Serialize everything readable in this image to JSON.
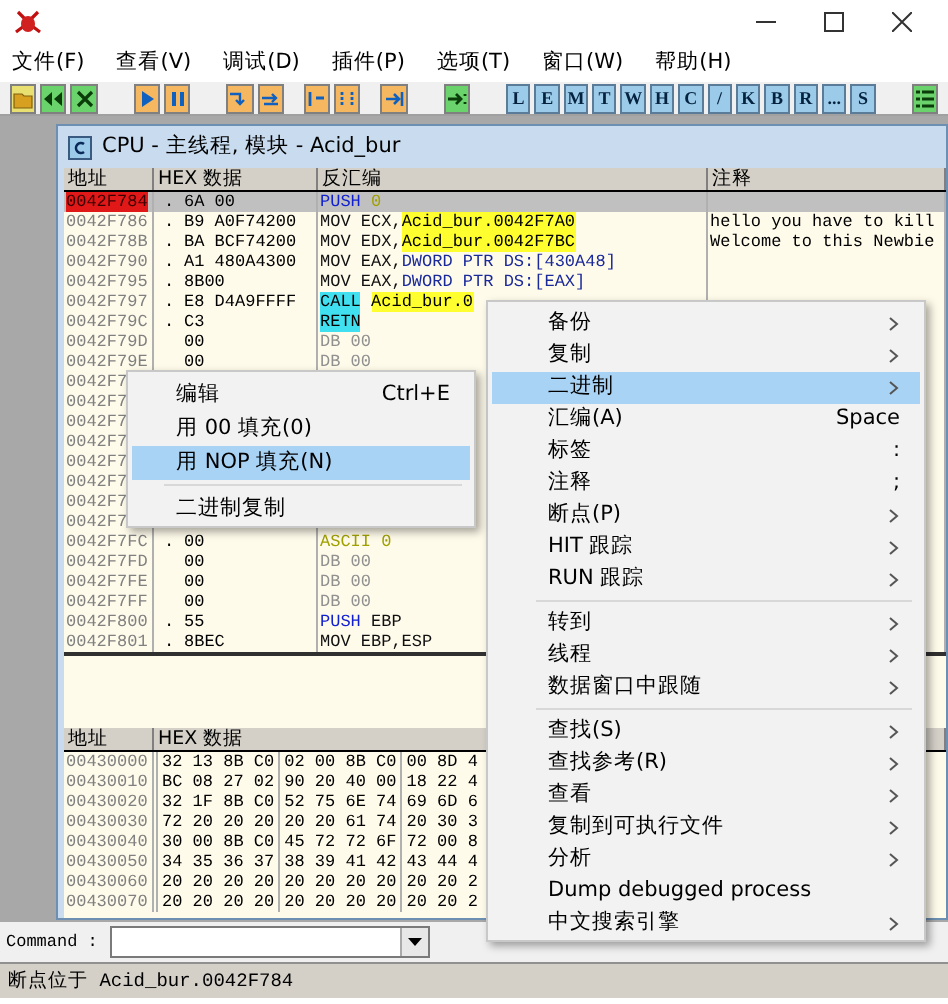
{
  "menu_bar": [
    "文件(F)",
    "查看(V)",
    "调试(D)",
    "插件(P)",
    "选项(T)",
    "窗口(W)",
    "帮助(H)"
  ],
  "toolbar_letters": [
    "L",
    "E",
    "M",
    "T",
    "W",
    "H",
    "C",
    "/",
    "K",
    "B",
    "R",
    "...",
    "S"
  ],
  "cpu_window": {
    "title": "CPU - 主线程, 模块 - Acid_bur",
    "disasm_columns": [
      "地址",
      "HEX 数据",
      "反汇编",
      "注释"
    ],
    "disasm_rows": [
      {
        "address": "0042F784",
        "marker": ".",
        "hex": "6A 00",
        "kind": "push",
        "mnemonic": "PUSH",
        "operand": {
          "text": "0",
          "kind": "imm"
        },
        "selected": true
      },
      {
        "address": "0042F786",
        "marker": ".",
        "hex": "B9 A0F74200",
        "kind": "mov",
        "mnemonic": "MOV ECX,",
        "operand": {
          "text": "Acid_bur.0042F7A0",
          "kind": "label"
        },
        "comment": "hello you have to kill",
        "selected": false
      },
      {
        "address": "0042F78B",
        "marker": ".",
        "hex": "BA BCF74200",
        "kind": "mov",
        "mnemonic": "MOV EDX,",
        "operand": {
          "text": "Acid_bur.0042F7BC",
          "kind": "label"
        },
        "comment": "Welcome to this Newbie",
        "selected": false
      },
      {
        "address": "0042F790",
        "marker": ".",
        "hex": "A1 480A4300",
        "kind": "mov",
        "mnemonic": "MOV EAX,",
        "operand": {
          "text": "DWORD PTR DS:[430A48]",
          "kind": "mem"
        },
        "selected": false
      },
      {
        "address": "0042F795",
        "marker": ".",
        "hex": "8B00",
        "kind": "mov",
        "mnemonic": "MOV EAX,",
        "operand": {
          "text": "DWORD PTR DS:[EAX]",
          "kind": "mem"
        },
        "selected": false
      },
      {
        "address": "0042F797",
        "marker": ".",
        "hex": "E8 D4A9FFFF",
        "kind": "call",
        "mnemonic": "CALL",
        "operand": {
          "text": "Acid_bur.0",
          "kind": "label"
        },
        "selected": false
      },
      {
        "address": "0042F79C",
        "marker": ".",
        "hex": "C3",
        "kind": "call",
        "mnemonic": "RETN",
        "selected": false
      },
      {
        "address": "0042F79D",
        "hex": "00",
        "kind": "db",
        "mnemonic": "DB 00",
        "selected": false
      },
      {
        "address": "0042F79E",
        "hex": "00",
        "kind": "db",
        "mnemonic": "DB 00",
        "selected": false
      },
      {
        "address": "0042F7",
        "selected": false
      },
      {
        "address": "0042F7",
        "selected": false
      },
      {
        "address": "0042F7",
        "selected": false
      },
      {
        "address": "0042F7",
        "selected": false
      },
      {
        "address": "0042F7",
        "selected": false
      },
      {
        "address": "0042F7",
        "selected": false
      },
      {
        "address": "0042F7",
        "selected": false
      },
      {
        "address": "0042F7",
        "selected": false
      },
      {
        "address": "0042F7FC",
        "marker": ".",
        "hex": "00",
        "kind": "ascii",
        "mnemonic": "ASCII 0",
        "selected": false
      },
      {
        "address": "0042F7FD",
        "hex": "00",
        "kind": "db",
        "mnemonic": "DB 00",
        "selected": false
      },
      {
        "address": "0042F7FE",
        "hex": "00",
        "kind": "db",
        "mnemonic": "DB 00",
        "selected": false
      },
      {
        "address": "0042F7FF",
        "hex": "00",
        "kind": "db",
        "mnemonic": "DB 00",
        "selected": false
      },
      {
        "address": "0042F800",
        "marker": ".",
        "hex": "55",
        "kind": "push",
        "mnemonic": "PUSH",
        "operand": {
          "text": "EBP",
          "kind": "reg"
        },
        "selected": false
      },
      {
        "address": "0042F801",
        "marker": ".",
        "hex": "8BEC",
        "kind": "mov",
        "mnemonic": "MOV EBP,ESP",
        "selected": false
      }
    ],
    "dump_columns": [
      "地址",
      "HEX 数据"
    ],
    "dump_rows": [
      {
        "address": "00430000",
        "groups": [
          "32 13 8B C0",
          "02 00 8B C0",
          "00 8D 4"
        ]
      },
      {
        "address": "00430010",
        "groups": [
          "BC 08 27 02",
          "90 20 40 00",
          "18 22 4"
        ]
      },
      {
        "address": "00430020",
        "groups": [
          "32 1F 8B C0",
          "52 75 6E 74",
          "69 6D 6"
        ]
      },
      {
        "address": "00430030",
        "groups": [
          "72 20 20 20",
          "20 20 61 74",
          "20 30 3"
        ]
      },
      {
        "address": "00430040",
        "groups": [
          "30 00 8B C0",
          "45 72 72 6F",
          "72 00 8"
        ]
      },
      {
        "address": "00430050",
        "groups": [
          "34 35 36 37",
          "38 39 41 42",
          "43 44 4"
        ]
      },
      {
        "address": "00430060",
        "groups": [
          "20 20 20 20",
          "20 20 20 20",
          "20 20 2"
        ]
      },
      {
        "address": "00430070",
        "groups": [
          "20 20 20 20",
          "20 20 20 20",
          "20 20 2"
        ]
      }
    ]
  },
  "command_bar": {
    "label": "Command :"
  },
  "status_bar": "断点位于 Acid_bur.0042F784",
  "context_menu": [
    {
      "kind": "item",
      "label": "备份",
      "submenu": true,
      "selected": false
    },
    {
      "kind": "item",
      "label": "复制",
      "submenu": true,
      "selected": false
    },
    {
      "kind": "item",
      "label": "二进制",
      "submenu": true,
      "selected": true
    },
    {
      "kind": "item",
      "label": "汇编(A)",
      "shortcut": "Space",
      "submenu": false,
      "selected": false
    },
    {
      "kind": "item",
      "label": "标签",
      "shortcut": ":",
      "submenu": false,
      "selected": false
    },
    {
      "kind": "item",
      "label": "注释",
      "shortcut": ";",
      "submenu": false,
      "selected": false
    },
    {
      "kind": "item",
      "label": "断点(P)",
      "submenu": true,
      "selected": false
    },
    {
      "kind": "item",
      "label": "HIT 跟踪",
      "submenu": true,
      "selected": false
    },
    {
      "kind": "item",
      "label": "RUN 跟踪",
      "submenu": true,
      "selected": false
    },
    {
      "kind": "separator"
    },
    {
      "kind": "item",
      "label": "转到",
      "submenu": true,
      "selected": false
    },
    {
      "kind": "item",
      "label": "线程",
      "submenu": true,
      "selected": false
    },
    {
      "kind": "item",
      "label": "数据窗口中跟随",
      "submenu": true,
      "selected": false
    },
    {
      "kind": "separator"
    },
    {
      "kind": "item",
      "label": "查找(S)",
      "submenu": true,
      "selected": false
    },
    {
      "kind": "item",
      "label": "查找参考(R)",
      "submenu": true,
      "selected": false
    },
    {
      "kind": "item",
      "label": "查看",
      "submenu": true,
      "selected": false
    },
    {
      "kind": "item",
      "label": "复制到可执行文件",
      "submenu": true,
      "selected": false
    },
    {
      "kind": "item",
      "label": "分析",
      "submenu": true,
      "selected": false
    },
    {
      "kind": "item",
      "label": "Dump debugged process",
      "submenu": false,
      "selected": false
    },
    {
      "kind": "item",
      "label": "中文搜索引擎",
      "submenu": true,
      "selected": false
    }
  ],
  "binary_submenu": [
    {
      "kind": "item",
      "label": "编辑",
      "shortcut": "Ctrl+E",
      "selected": false
    },
    {
      "kind": "item",
      "label": "用 00 填充(0)",
      "selected": false
    },
    {
      "kind": "item",
      "label": "用 NOP 填充(N)",
      "selected": true
    },
    {
      "kind": "separator"
    },
    {
      "kind": "item",
      "label": "二进制复制",
      "selected": false
    }
  ]
}
